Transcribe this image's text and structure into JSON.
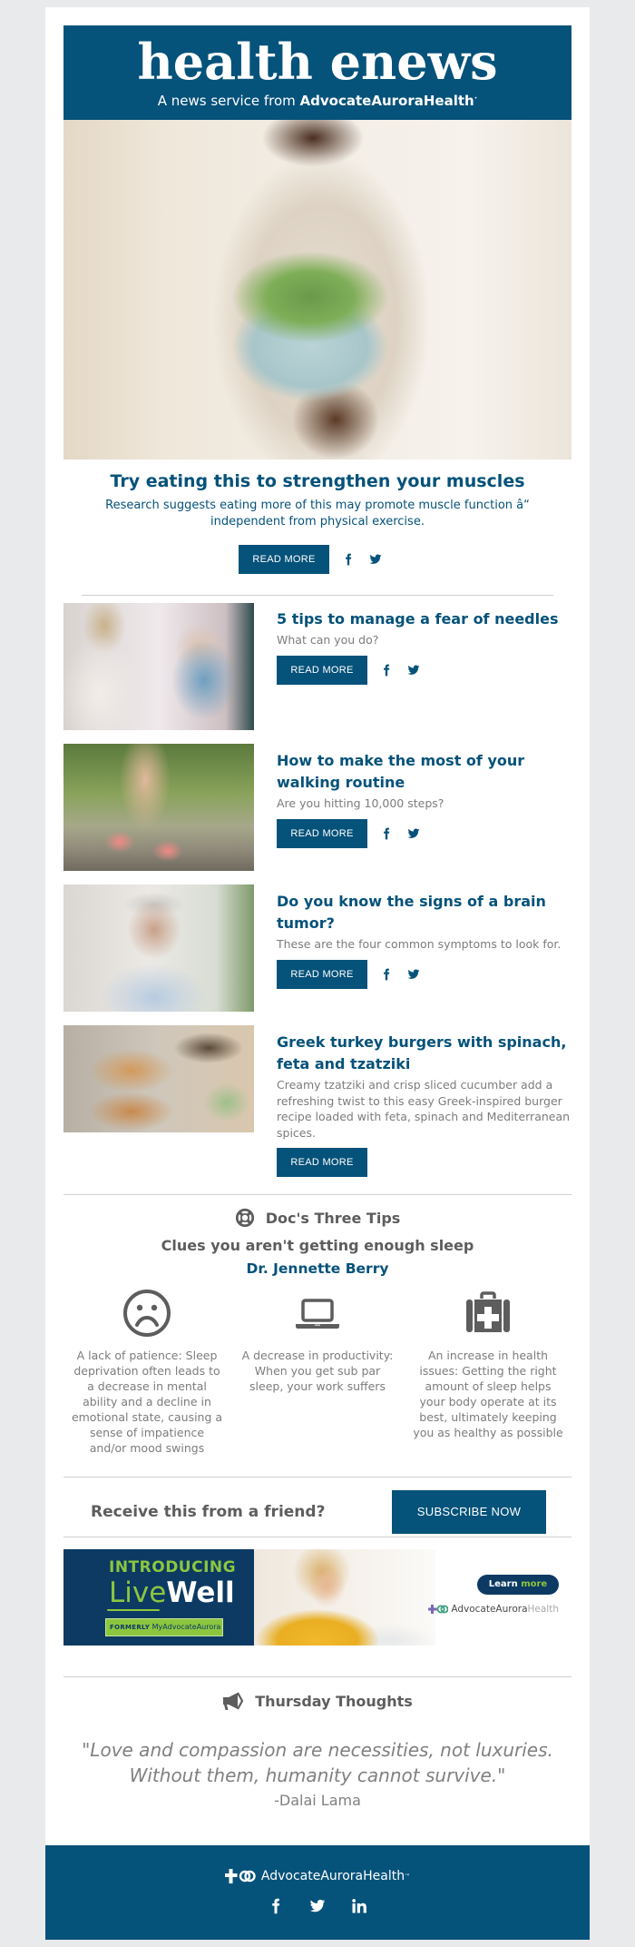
{
  "masthead": {
    "title": "health enews",
    "subtitle_prefix": "A news service from ",
    "subtitle_brand": "AdvocateAuroraHealth"
  },
  "hero": {
    "image_alt": "Person holding a bowl of salad",
    "title": "Try eating this to strengthen your muscles",
    "description": "Research suggests eating more of this may promote muscle function â“ independent from physical exercise.",
    "button_label": "Read More",
    "share_icons": [
      "facebook-icon",
      "twitter-icon"
    ]
  },
  "articles": [
    {
      "image_alt": "Adult putting a face mask on a child",
      "title": "5 tips to manage a fear of needles",
      "description": "What can you do?",
      "button_label": "Read More",
      "share": true
    },
    {
      "image_alt": "Legs walking in sneakers on a path",
      "title": "How to make the most of your walking routine",
      "description": "Are you hitting 10,000 steps?",
      "button_label": "Read More",
      "share": true
    },
    {
      "image_alt": "Man holding his head in pain",
      "title": "Do you know the signs of a brain tumor?",
      "description": "These are the four common symptoms to look for.",
      "button_label": "Read More",
      "share": true
    },
    {
      "image_alt": "Greek turkey burgers with cucumber and onion",
      "title": "Greek turkey burgers with spinach, feta and tzatziki",
      "description": "Creamy tzatziki and crisp sliced cucumber add a refreshing twist to this easy Greek-inspired burger recipe loaded with feta, spinach and Mediterranean spices.",
      "button_label": "Read More",
      "share": false
    }
  ],
  "doc_tips": {
    "icon": "lifebuoy-icon",
    "heading": "Doc's Three Tips",
    "subtitle": "Clues you aren't getting enough sleep",
    "author": "Dr. Jennette Berry",
    "tips": [
      {
        "icon": "sad-face-icon",
        "text": "A lack of patience: Sleep deprivation often leads to a decrease in mental ability and a decline in emotional state, causing a sense of impatience and/or mood swings"
      },
      {
        "icon": "laptop-icon",
        "text": "A decrease in productivity: When you get sub par sleep, your work suffers"
      },
      {
        "icon": "medical-kit-icon",
        "text": "An increase in health issues: Getting the right amount of sleep helps your body operate at its best, ultimately keeping you as healthy as possible"
      }
    ]
  },
  "subscribe": {
    "prompt": "Receive this from a friend?",
    "button_label": "SUBSCRIBE NOW"
  },
  "banner": {
    "introducing": "INTRODUCING",
    "live": "Live",
    "well": "Well",
    "formerly_label": "FORMERLY",
    "formerly_brand": "MyAdvocateAurora",
    "learn_prefix": "Learn ",
    "learn_suffix": "more",
    "brand_main": "AdvocateAurora",
    "brand_health": "Health"
  },
  "thursday_thoughts": {
    "icon": "megaphone-icon",
    "heading": "Thursday Thoughts",
    "quote": "\"Love and compassion are necessities, not luxuries. Without them, humanity cannot survive.\"",
    "author": "-Dalai Lama"
  },
  "footer": {
    "brand": "AdvocateAuroraHealth",
    "trademark": "™",
    "social": [
      "facebook-icon",
      "twitter-icon",
      "linkedin-icon"
    ]
  },
  "colors": {
    "brand_blue": "#05527a",
    "banner_navy": "#0c3a63",
    "banner_green": "#8cc63f",
    "text_gray": "#7c7c7c",
    "heading_gray": "#5d5d5d",
    "page_bg": "#e9eaec"
  }
}
